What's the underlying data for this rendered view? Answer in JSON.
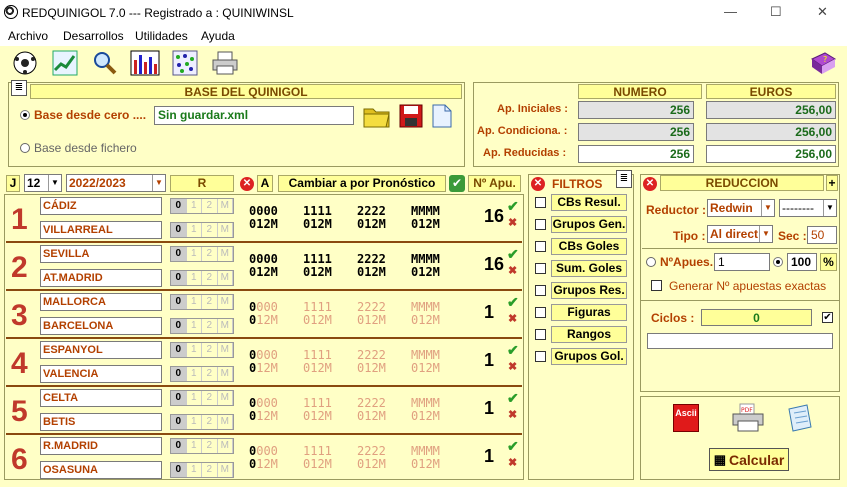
{
  "window": {
    "title": "REDQUINIGOL 7.0 --- Registrado a : QUINIWINSL",
    "minimize": "—",
    "maximize": "☐",
    "close": "✕"
  },
  "menu": [
    "Archivo",
    "Desarrollos",
    "Utilidades",
    "Ayuda"
  ],
  "base": {
    "header": "BASE DEL QUINIGOL",
    "option1": "Base desde cero ....",
    "filename": "Sin guardar.xml",
    "option2": "Base desde fichero"
  },
  "stats": {
    "col_numero": "NUMERO",
    "col_euros": "EUROS",
    "rows": [
      {
        "label": "Ap. Iniciales :",
        "numero": "256",
        "euros": "256,00"
      },
      {
        "label": "Ap. Condiciona. :",
        "numero": "256",
        "euros": "256,00"
      },
      {
        "label": "Ap. Reducidas :",
        "numero": "256",
        "euros": "256,00"
      }
    ]
  },
  "bar": {
    "j": "J",
    "jornada": "12",
    "season": "2022/2023",
    "r": "R",
    "a": "A",
    "change": "Cambiar a por Pronóstico",
    "napu": "Nº Apu."
  },
  "picks_labels": [
    "0",
    "1",
    "2",
    "M"
  ],
  "group_rows": {
    "top": "0000 1111 2222 MMMM",
    "bottom": "012M 012M 012M 012M"
  },
  "matches": [
    {
      "n": "1",
      "home": "CÁDIZ",
      "away": "VILLARREAL",
      "apu": "16",
      "active": true
    },
    {
      "n": "2",
      "home": "SEVILLA",
      "away": "AT.MADRID",
      "apu": "16",
      "active": true
    },
    {
      "n": "3",
      "home": "MALLORCA",
      "away": "BARCELONA",
      "apu": "1",
      "active": false
    },
    {
      "n": "4",
      "home": "ESPANYOL",
      "away": "VALENCIA",
      "apu": "1",
      "active": false
    },
    {
      "n": "5",
      "home": "CELTA",
      "away": "BETIS",
      "apu": "1",
      "active": false
    },
    {
      "n": "6",
      "home": "R.MADRID",
      "away": "OSASUNA",
      "apu": "1",
      "active": false
    }
  ],
  "filtros": {
    "header": "FILTROS",
    "items": [
      "CBs Resul.",
      "Grupos Gen.",
      "CBs Goles",
      "Sum. Goles",
      "Grupos Res.",
      "Figuras",
      "Rangos",
      "Grupos Gol."
    ]
  },
  "reduccion": {
    "header": "REDUCCION",
    "plus": "+",
    "reductor_label": "Reductor :",
    "reductor_value": "Redwin",
    "reductor_value2": "--------",
    "tipo_label": "Tipo :",
    "tipo_value": "Al direct",
    "sec_label": "Sec :",
    "sec_value": "50",
    "napues_label": "NºApues.",
    "napues_value": "1",
    "pct_value": "100",
    "pct_sign": "%",
    "generar": "Generar Nº apuestas exactas",
    "ciclos_label": "Ciclos :",
    "ciclos_value": "0",
    "calcular": "Calcular",
    "ascii": "Ascii",
    "pdf": "PDF"
  }
}
